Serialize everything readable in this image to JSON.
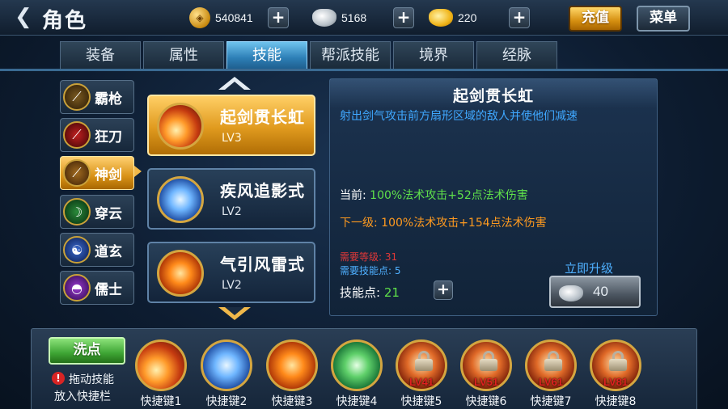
{
  "header": {
    "title": "角色",
    "coins": "540841",
    "silver": "5168",
    "gold": "220",
    "recharge_label": "充值",
    "menu_label": "菜单"
  },
  "tabs": [
    {
      "label": "装备",
      "active": false
    },
    {
      "label": "属性",
      "active": false
    },
    {
      "label": "技能",
      "active": true
    },
    {
      "label": "帮派技能",
      "active": false
    },
    {
      "label": "境界",
      "active": false
    },
    {
      "label": "经脉",
      "active": false
    }
  ],
  "schools": [
    {
      "label": "霸枪",
      "icon": "spear-icon",
      "active": false
    },
    {
      "label": "狂刀",
      "icon": "blade-icon",
      "active": false
    },
    {
      "label": "神剑",
      "icon": "sword-icon",
      "active": true
    },
    {
      "label": "穿云",
      "icon": "bow-icon",
      "active": false
    },
    {
      "label": "道玄",
      "icon": "taoist-icon",
      "active": false
    },
    {
      "label": "儒士",
      "icon": "fan-icon",
      "active": false
    }
  ],
  "skills": [
    {
      "name": "起剑贯长虹",
      "level": "LV3",
      "icon": "sword-fire-icon",
      "active": true
    },
    {
      "name": "疾风追影式",
      "level": "LV2",
      "icon": "wind-sword-icon",
      "active": false
    },
    {
      "name": "气引风雷式",
      "level": "LV2",
      "icon": "thunder-sword-icon",
      "active": false
    }
  ],
  "detail": {
    "title": "起剑贯长虹",
    "description": "射出剑气攻击前方扇形区域的敌人并使他们减速",
    "current_label": "当前:",
    "current_value": "100%法术攻击+52点法术伤害",
    "next_label": "下一级:",
    "next_value": "100%法术攻击+154点法术伤害",
    "req_level": "需要等级: 31",
    "req_points": "需要技能点: 5",
    "points_label": "技能点:",
    "points_value": "21",
    "upgrade_label": "立即升级",
    "upgrade_cost": "40"
  },
  "bottom": {
    "wash_label": "洗点",
    "hint_line1": "拖动技能",
    "hint_line2": "放入快捷栏",
    "slots": [
      {
        "label": "快捷键1",
        "icon": "sword-fire-icon",
        "locked": false,
        "lv": ""
      },
      {
        "label": "快捷键2",
        "icon": "wind-sword-icon",
        "locked": false,
        "lv": ""
      },
      {
        "label": "快捷键3",
        "icon": "thunder-sword-icon",
        "locked": false,
        "lv": ""
      },
      {
        "label": "快捷键4",
        "icon": "green-sword-icon",
        "locked": false,
        "lv": ""
      },
      {
        "label": "快捷键5",
        "icon": "lock-icon",
        "locked": true,
        "lv": "LV41"
      },
      {
        "label": "快捷键6",
        "icon": "lock-icon",
        "locked": true,
        "lv": "LV51"
      },
      {
        "label": "快捷键7",
        "icon": "lock-icon",
        "locked": true,
        "lv": "LV61"
      },
      {
        "label": "快捷键8",
        "icon": "lock-icon",
        "locked": true,
        "lv": "LV81"
      }
    ]
  }
}
